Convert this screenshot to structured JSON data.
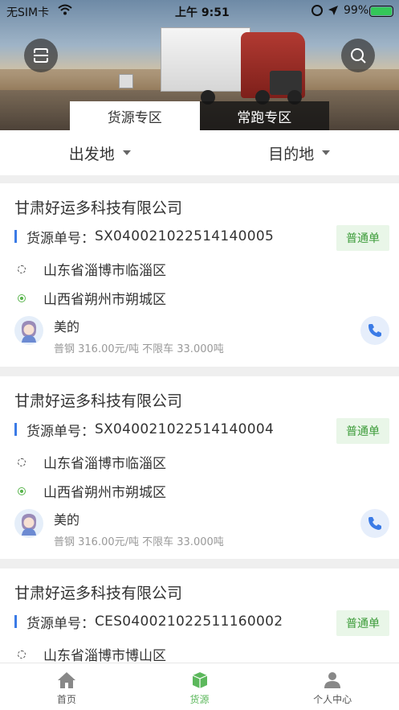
{
  "status_bar": {
    "carrier": "无SIM卡",
    "time": "上午 9:51",
    "battery_pct": "99%"
  },
  "header": {
    "tabs": [
      {
        "label": "货源专区",
        "active": true
      },
      {
        "label": "常跑专区",
        "active": false
      }
    ]
  },
  "filters": {
    "origin_label": "出发地",
    "destination_label": "目的地"
  },
  "cards": [
    {
      "company": "甘肃好运多科技有限公司",
      "order_label": "货源单号：",
      "order_no": "SX040021022514140005",
      "badge": "普通单",
      "origin": "山东省淄博市临淄区",
      "destination": "山西省朔州市朔城区",
      "shipper_name": "美的",
      "shipper_info": "普钢 316.00元/吨 不限车 33.000吨"
    },
    {
      "company": "甘肃好运多科技有限公司",
      "order_label": "货源单号：",
      "order_no": "SX040021022514140004",
      "badge": "普通单",
      "origin": "山东省淄博市临淄区",
      "destination": "山西省朔州市朔城区",
      "shipper_name": "美的",
      "shipper_info": "普钢 316.00元/吨 不限车 33.000吨"
    },
    {
      "company": "甘肃好运多科技有限公司",
      "order_label": "货源单号：",
      "order_no": "CES040021022511160002",
      "badge": "普通单",
      "origin": "山东省淄博市博山区"
    }
  ],
  "tabbar": {
    "items": [
      {
        "label": "首页",
        "icon": "home-icon"
      },
      {
        "label": "货源",
        "icon": "cargo-box-icon",
        "active": true
      },
      {
        "label": "个人中心",
        "icon": "person-icon"
      }
    ]
  },
  "colors": {
    "accent_green": "#5cb85c",
    "accent_blue": "#3b7be6",
    "badge_bg": "#e9f6e8"
  }
}
